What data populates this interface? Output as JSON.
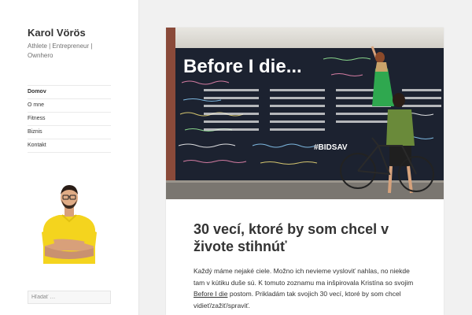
{
  "site": {
    "title": "Karol Vörös",
    "description": "Athlete | Entrepreneur | Ownhero"
  },
  "nav": {
    "items": [
      {
        "label": "Domov",
        "active": true
      },
      {
        "label": "O mne",
        "active": false
      },
      {
        "label": "Fitness",
        "active": false
      },
      {
        "label": "Biznis",
        "active": false
      },
      {
        "label": "Kontakt",
        "active": false
      }
    ]
  },
  "search": {
    "placeholder": "Hľadať …"
  },
  "post": {
    "image_text": "Before I die...",
    "image_tag": "#BIDSAV",
    "title": "30 vecí, ktoré by som chcel v živote stihnúť",
    "content_before_link": "Každý máme nejaké ciele. Možno ich nevieme vysloviť nahlas, no niekde tam v kútiku duše sú. K tomuto zoznamu ma inšpirovala Kristína so svojim ",
    "link_text": "Before I die",
    "content_after_link": " postom. Prikladám tak svojich 30 vecí, ktoré by som chcel vidieť/zažiť/spraviť."
  },
  "colors": {
    "background": "#f1f1f1",
    "sidebar": "#ffffff",
    "chalkboard": "#1c2230",
    "avatar_shirt": "#f4d41e"
  }
}
